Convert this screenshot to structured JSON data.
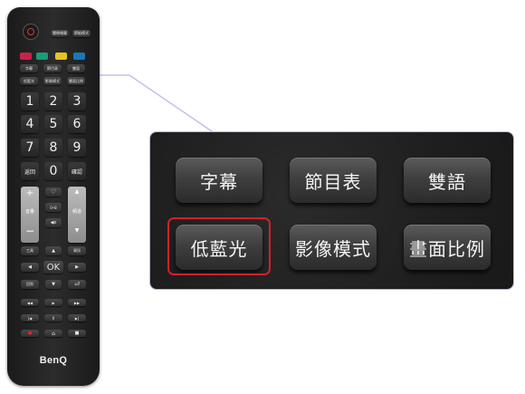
{
  "remote": {
    "brand": "BenQ",
    "top_row": [
      "關閉螢幕",
      "節能模式"
    ],
    "colors": [
      "#c9224a",
      "#1c9a7a",
      "#e5c420",
      "#1a78b8"
    ],
    "func_row1": [
      "字幕",
      "節目表",
      "雙語"
    ],
    "func_row2": [
      "低藍光",
      "影像模式",
      "畫面比例"
    ],
    "numbers": [
      "1",
      "2",
      "3",
      "4",
      "5",
      "6",
      "7",
      "8",
      "9"
    ],
    "return_label": "返回",
    "zero": "0",
    "confirm_label": "確認",
    "plus": "+",
    "heart": "♡",
    "up_arrow": "▲",
    "volume_label": "音量",
    "dots": "0•8",
    "channel_label": "頻道",
    "minus": "−",
    "mute": "◀x",
    "down_arrow": "▼",
    "tools_label": "工具",
    "info_label": "資訊",
    "ok": "OK",
    "left": "◀",
    "right": "▶",
    "exit_label": "回到",
    "back_icon": "⏎",
    "rew": "◀◀",
    "play": "▶",
    "ff": "▶▶",
    "prev": "|◀",
    "pause": "II",
    "next": "▶|",
    "record": "●",
    "home": "⌂",
    "stop": "■"
  },
  "zoom": {
    "row1": [
      "字幕",
      "節目表",
      "雙語"
    ],
    "row2": [
      "低藍光",
      "影像模式",
      "畫面比例"
    ],
    "highlight_color": "#d32028",
    "border_color": "#b9b4e6"
  }
}
